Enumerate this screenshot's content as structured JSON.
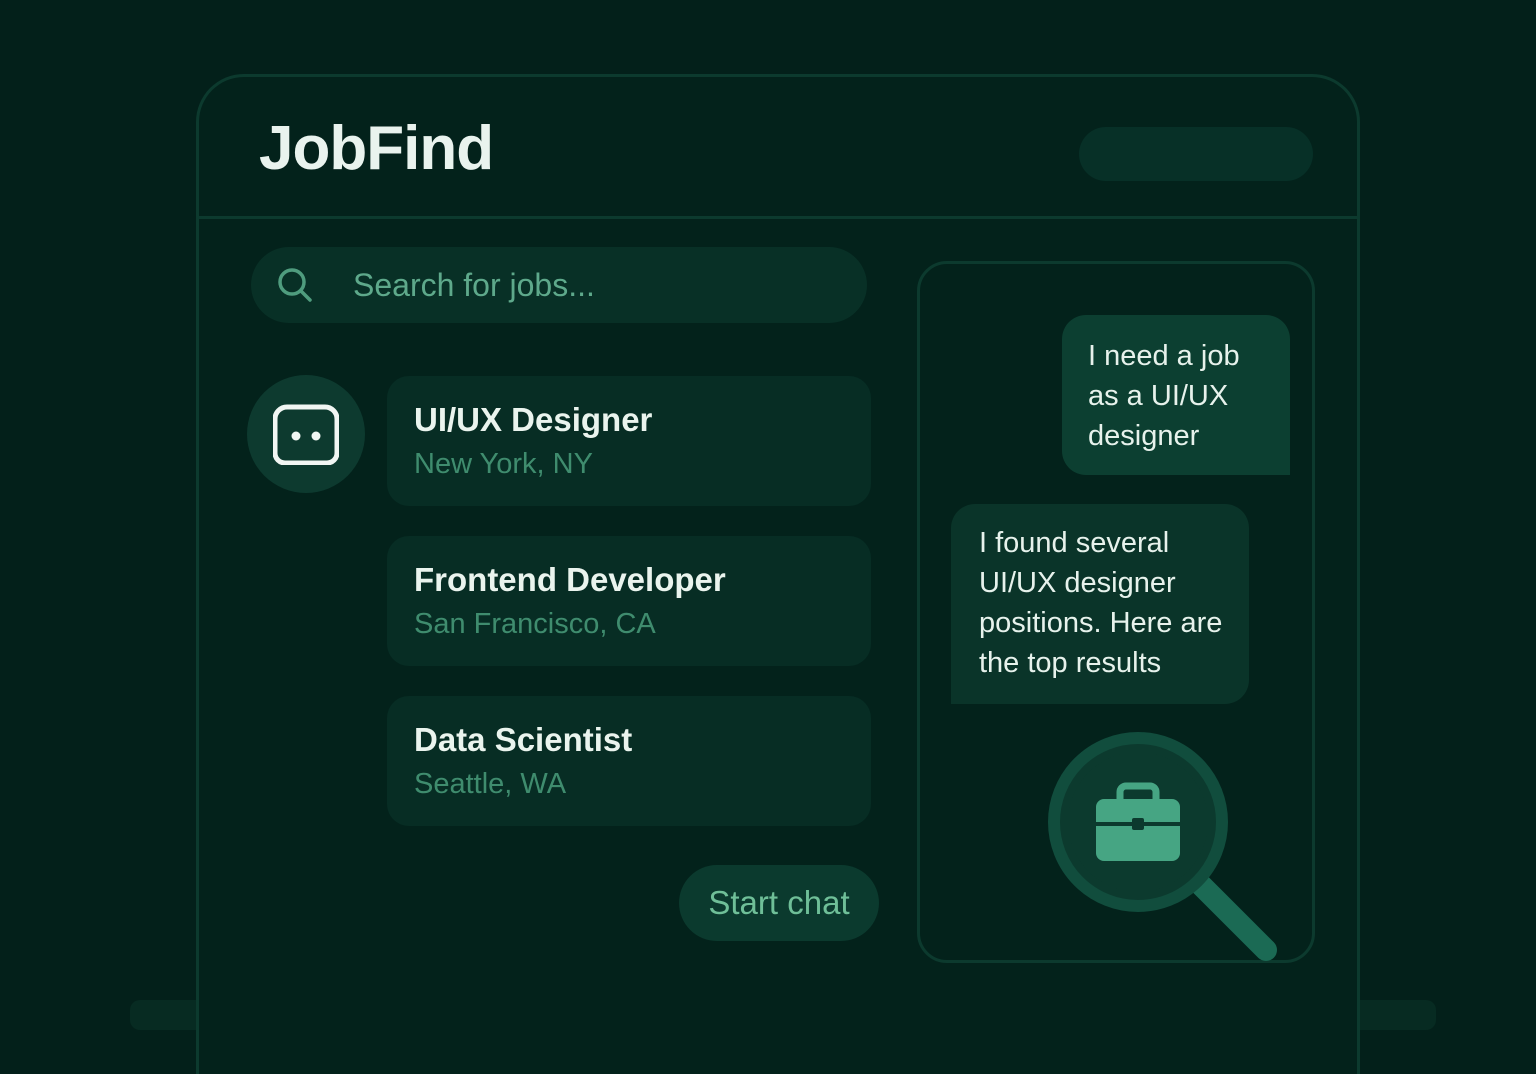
{
  "app": {
    "title": "JobFind"
  },
  "search": {
    "placeholder": "Search for jobs...",
    "icon": "search-icon"
  },
  "avatar": {
    "icon": "bot-icon"
  },
  "jobs": [
    {
      "title": "UI/UX Designer",
      "location": "New York, NY"
    },
    {
      "title": "Frontend Developer",
      "location": "San Francisco, CA"
    },
    {
      "title": "Data Scientist",
      "location": "Seattle, WA"
    }
  ],
  "actions": {
    "start_chat": "Start chat"
  },
  "chat": {
    "messages": [
      {
        "role": "user",
        "text": "I need a job as a UI/UX designer"
      },
      {
        "role": "bot",
        "text": "I found several UI/UX designer positions. Here are the top results"
      }
    ],
    "illustration": "job-search-magnifier-icon"
  },
  "colors": {
    "background": "#03201a",
    "panel": "#03221b",
    "card": "#072d24",
    "accent": "#6fbf98",
    "text": "#eaf4ee",
    "muted": "#3f8c6e"
  }
}
